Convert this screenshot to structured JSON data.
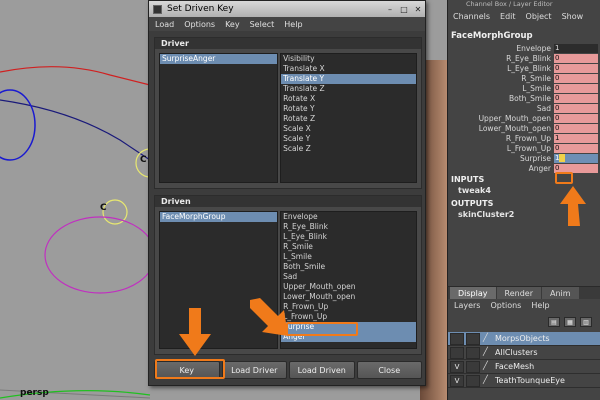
{
  "viewport": {
    "panel_label": "persp",
    "locator_label_1": "C",
    "locator_label_2": "C",
    "locator_label_3": "C"
  },
  "sdk_window": {
    "title": "Set Driven Key",
    "window_controls": [
      "–",
      "□",
      "✕"
    ],
    "menu": [
      "Load",
      "Options",
      "Key",
      "Select",
      "Help"
    ],
    "driver": {
      "header": "Driver",
      "objects": [
        "SurpriseAnger"
      ],
      "attributes": [
        "Visibility",
        "Translate X",
        "Translate Y",
        "Translate Z",
        "Rotate X",
        "Rotate Y",
        "Rotate Z",
        "Scale X",
        "Scale Y",
        "Scale Z"
      ],
      "selected_attribute": "Translate Y"
    },
    "driven": {
      "header": "Driven",
      "objects": [
        "FaceMorphGroup"
      ],
      "attributes": [
        "Envelope",
        "R_Eye_Blink",
        "L_Eye_Blink",
        "R_Smile",
        "L_Smile",
        "Both_Smile",
        "Sad",
        "Upper_Mouth_open",
        "Lower_Mouth_open",
        "R_Frown_Up",
        "L_Frown_Up",
        "Surprise",
        "Anger"
      ],
      "selected_attributes": [
        "Surprise",
        "Anger"
      ]
    },
    "buttons": {
      "key": "Key",
      "load_driver": "Load Driver",
      "load_driven": "Load Driven",
      "close": "Close"
    }
  },
  "channel_box": {
    "title": "Channel Box / Layer Editor",
    "menu": [
      "Channels",
      "Edit",
      "Object",
      "Show"
    ],
    "node_name": "FaceMorphGroup",
    "attributes": [
      {
        "name": "Envelope",
        "value": "1",
        "style": "plain"
      },
      {
        "name": "R_Eye_Blink",
        "value": "0",
        "style": "keyed"
      },
      {
        "name": "L_Eye_Blink",
        "value": "0",
        "style": "keyed"
      },
      {
        "name": "R_Smile",
        "value": "0",
        "style": "keyed"
      },
      {
        "name": "L_Smile",
        "value": "0",
        "style": "keyed"
      },
      {
        "name": "Both_Smile",
        "value": "0",
        "style": "keyed"
      },
      {
        "name": "Sad",
        "value": "0",
        "style": "keyed"
      },
      {
        "name": "Upper_Mouth_open",
        "value": "0",
        "style": "keyed"
      },
      {
        "name": "Lower_Mouth_open",
        "value": "0",
        "style": "keyed"
      },
      {
        "name": "R_Frown_Up",
        "value": "1",
        "style": "keyed"
      },
      {
        "name": "L_Frown_Up",
        "value": "0",
        "style": "keyed"
      },
      {
        "name": "Surprise",
        "value": "1",
        "style": "editing"
      },
      {
        "name": "Anger",
        "value": "0",
        "style": "keyed"
      }
    ],
    "inputs_label": "INPUTS",
    "input_node": "tweak4",
    "outputs_label": "OUTPUTS",
    "output_node": "skinCluster2"
  },
  "layer_editor": {
    "tabs": [
      "Display",
      "Render",
      "Anim"
    ],
    "active_tab": "Display",
    "menu": [
      "Layers",
      "Options",
      "Help"
    ],
    "layers": [
      {
        "name": "MorpsObjects",
        "v": "",
        "selected": true
      },
      {
        "name": "AllClusters",
        "v": "",
        "selected": false
      },
      {
        "name": "FaceMesh",
        "v": "V",
        "selected": false
      },
      {
        "name": "TeathTounqueEye",
        "v": "V",
        "selected": false
      }
    ]
  },
  "colors": {
    "annotation_orange": "#f07a1a",
    "selection_blue": "#6d8db1",
    "keyed_pink": "#e89a9a"
  }
}
